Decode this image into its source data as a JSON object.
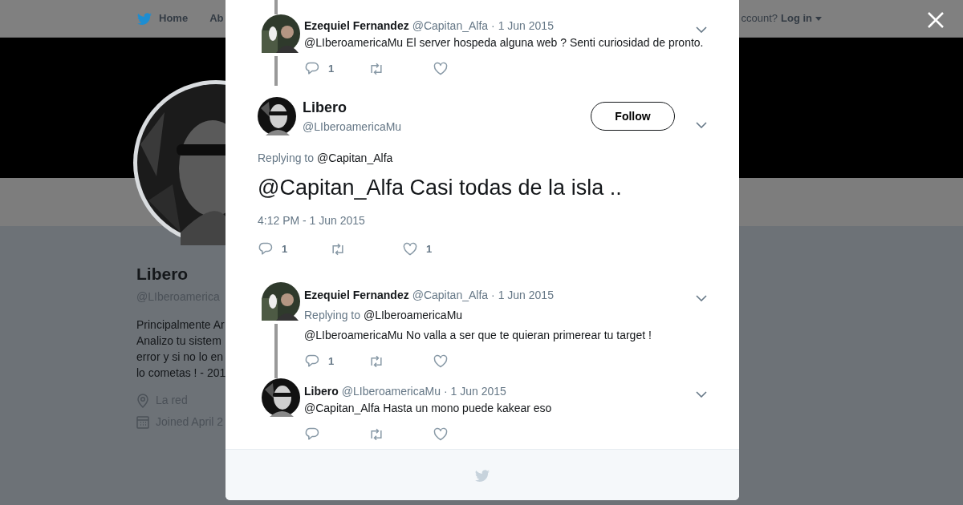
{
  "navbar": {
    "home": "Home",
    "about": "Ab",
    "account_prompt": "ccount?",
    "login": "Log in"
  },
  "profile": {
    "name": "Libero",
    "handle": "@LIberoamerica",
    "bio_lines": [
      "Principalmente Ar",
      "Analizo tu sistem",
      "error y si no lo en",
      "lo cometas ! - 201"
    ],
    "location": "La red",
    "joined": "Joined April 2"
  },
  "modal": {
    "tweets": [
      {
        "kind": "reply",
        "name": "Ezequiel Fernandez",
        "handle": "@Capitan_Alfa",
        "date": "· 1 Jun 2015",
        "text": "@LIberoamericaMu  El server hospeda alguna web ? Senti curiosidad de pronto.",
        "reply_count": "1",
        "thread_above": true,
        "thread_below": true
      },
      {
        "kind": "main",
        "name": "Libero",
        "handle": "@LIberoamericaMu",
        "follow": "Follow",
        "replying_label": "Replying to",
        "replying_to": "@Capitan_Alfa",
        "text": "@Capitan_Alfa Casi todas de la isla ..",
        "timestamp": "4:12 PM - 1 Jun 2015",
        "reply_count": "1",
        "like_count": "1",
        "thread_above": false,
        "thread_below": false
      },
      {
        "kind": "reply",
        "name": "Ezequiel Fernandez",
        "handle": "@Capitan_Alfa",
        "date": "· 1 Jun 2015",
        "replying_label": "Replying to",
        "replying_to": "@LIberoamericaMu",
        "text": "@LIberoamericaMu No valla a ser que te quieran primerear tu target !",
        "reply_count": "1",
        "thread_above": false,
        "thread_below": true
      },
      {
        "kind": "reply",
        "name": "Libero",
        "handle": "@LIberoamericaMu",
        "date": "· 1 Jun 2015",
        "text": "@Capitan_Alfa Hasta un mono puede kakear eso",
        "thread_above": false,
        "thread_below": false
      }
    ]
  }
}
